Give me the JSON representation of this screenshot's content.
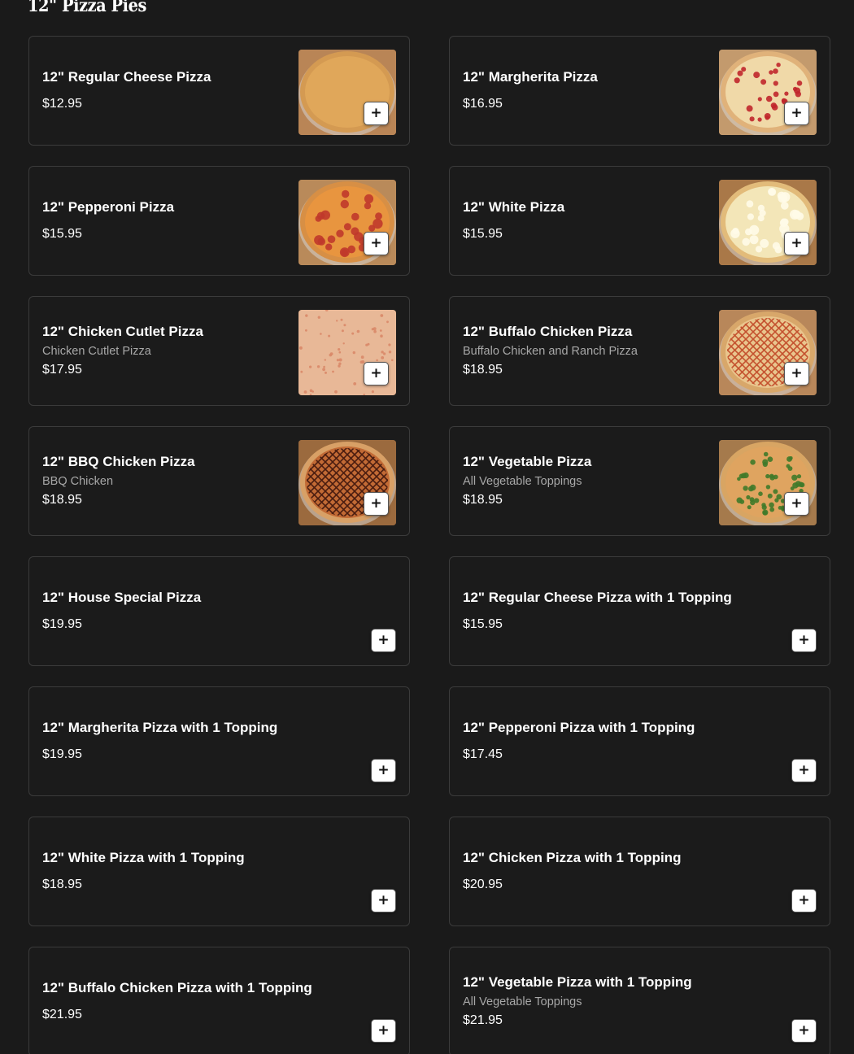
{
  "section": {
    "title": "12\" Pizza Pies"
  },
  "colors": {
    "background": "#1a1a1a",
    "card_border": "#3b3b3b",
    "text": "#ffffff",
    "description": "#a8a8a8",
    "add_button": "#ffffff"
  },
  "items": [
    {
      "name": "12\" Regular Cheese Pizza",
      "description": "",
      "price": "$12.95",
      "image": "cheese-pizza"
    },
    {
      "name": "12\" Margherita Pizza",
      "description": "",
      "price": "$16.95",
      "image": "margherita-pizza"
    },
    {
      "name": "12\" Pepperoni Pizza",
      "description": "",
      "price": "$15.95",
      "image": "pepperoni-pizza"
    },
    {
      "name": "12\" White Pizza",
      "description": "",
      "price": "$15.95",
      "image": "white-pizza"
    },
    {
      "name": "12\" Chicken Cutlet Pizza",
      "description": "Chicken Cutlet Pizza",
      "price": "$17.95",
      "image": "chicken-cutlet-pizza"
    },
    {
      "name": "12\" Buffalo Chicken Pizza",
      "description": "Buffalo Chicken and Ranch Pizza",
      "price": "$18.95",
      "image": "buffalo-chicken-pizza"
    },
    {
      "name": "12\" BBQ Chicken Pizza",
      "description": "BBQ Chicken",
      "price": "$18.95",
      "image": "bbq-chicken-pizza"
    },
    {
      "name": "12\" Vegetable Pizza",
      "description": "All Vegetable Toppings",
      "price": "$18.95",
      "image": "vegetable-pizza"
    },
    {
      "name": "12\" House Special Pizza",
      "description": "",
      "price": "$19.95",
      "image": ""
    },
    {
      "name": "12\" Regular Cheese Pizza with 1 Topping",
      "description": "",
      "price": "$15.95",
      "image": ""
    },
    {
      "name": "12\" Margherita Pizza with 1 Topping",
      "description": "",
      "price": "$19.95",
      "image": ""
    },
    {
      "name": "12\" Pepperoni Pizza with 1 Topping",
      "description": "",
      "price": "$17.45",
      "image": ""
    },
    {
      "name": "12\" White Pizza with 1 Topping",
      "description": "",
      "price": "$18.95",
      "image": ""
    },
    {
      "name": "12\" Chicken Pizza with 1 Topping",
      "description": "",
      "price": "$20.95",
      "image": ""
    },
    {
      "name": "12\" Buffalo Chicken Pizza with 1 Topping",
      "description": "",
      "price": "$21.95",
      "image": ""
    },
    {
      "name": "12\" Vegetable Pizza with 1 Topping",
      "description": "All Vegetable Toppings",
      "price": "$21.95",
      "image": ""
    }
  ],
  "add_button": {
    "icon": "plus-icon",
    "symbol": "+"
  }
}
